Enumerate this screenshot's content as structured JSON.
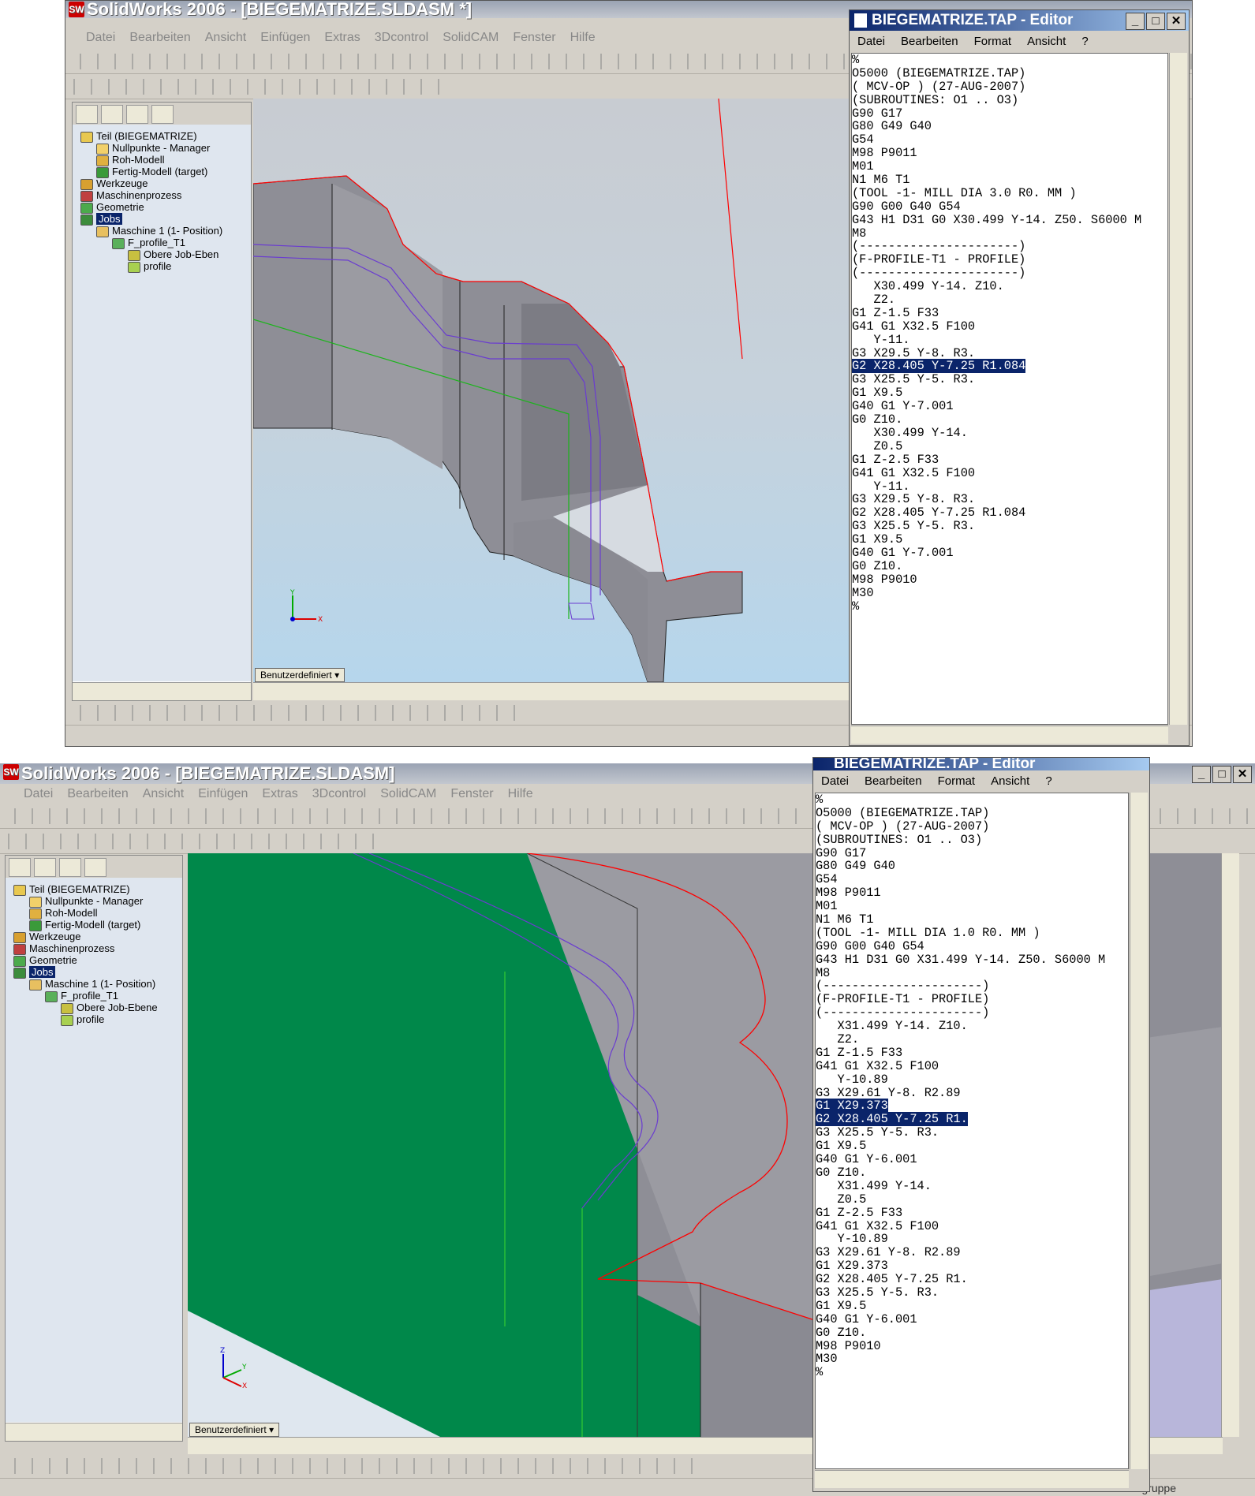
{
  "top": {
    "app_title": "SolidWorks 2006 - [BIEGEMATRIZE.SLDASM *]",
    "menu": [
      "Datei",
      "Bearbeiten",
      "Ansicht",
      "Einfügen",
      "Extras",
      "3Dcontrol",
      "SolidCAM",
      "Fenster",
      "Hilfe"
    ],
    "tree": [
      {
        "label": "Teil (BIEGEMATRIZE)",
        "icon": "part-icon"
      },
      {
        "label": "Nullpunkte - Manager",
        "icon": "origin-icon"
      },
      {
        "label": "Roh-Modell",
        "icon": "stock-icon"
      },
      {
        "label": "Fertig-Modell (target)",
        "icon": "target-icon"
      },
      {
        "label": "Werkzeuge",
        "icon": "tools-icon"
      },
      {
        "label": "Maschinenprozess",
        "icon": "machine-process-icon"
      },
      {
        "label": "Geometrie",
        "icon": "geometry-icon"
      },
      {
        "label": "Jobs",
        "icon": "jobs-icon"
      },
      {
        "label": "Maschine 1 (1- Position)",
        "icon": "machine-icon"
      },
      {
        "label": "F_profile_T1",
        "icon": "profile-job-icon"
      },
      {
        "label": "Obere Job-Eben",
        "icon": "plane-icon"
      },
      {
        "label": "profile",
        "icon": "profile-icon"
      }
    ],
    "view_mode": "Benutzerdefiniert",
    "editor": {
      "title": "BIEGEMATRIZE.TAP - Editor",
      "menu": [
        "Datei",
        "Bearbeiten",
        "Format",
        "Ansicht",
        "?"
      ],
      "lines": [
        "%",
        "O5000 (BIEGEMATRIZE.TAP)",
        "( MCV-OP ) (27-AUG-2007)",
        "(SUBROUTINES: O1 .. O3)",
        "G90 G17",
        "G80 G49 G40",
        "G54",
        "M98 P9011",
        "M01",
        "N1 M6 T1",
        "(TOOL -1- MILL DIA 3.0 R0. MM )",
        "G90 G00 G40 G54",
        "G43 H1 D31 G0 X30.499 Y-14. Z50. S6000 M",
        "M8",
        "(----------------------)",
        "(F-PROFILE-T1 - PROFILE)",
        "(----------------------)",
        "   X30.499 Y-14. Z10.",
        "   Z2.",
        "G1 Z-1.5 F33",
        "G41 G1 X32.5 F100",
        "   Y-11.",
        "G3 X29.5 Y-8. R3.",
        "G2 X28.405 Y-7.25 R1.084",
        "G3 X25.5 Y-5. R3.",
        "G1 X9.5",
        "G40 G1 Y-7.001",
        "G0 Z10.",
        "   X30.499 Y-14.",
        "   Z0.5",
        "G1 Z-2.5 F33",
        "G41 G1 X32.5 F100",
        "   Y-11.",
        "G3 X29.5 Y-8. R3.",
        "G2 X28.405 Y-7.25 R1.084",
        "G3 X25.5 Y-5. R3.",
        "G1 X9.5",
        "G40 G1 Y-7.001",
        "G0 Z10.",
        "M98 P9010",
        "M30",
        "%"
      ],
      "highlighted": [
        23
      ]
    }
  },
  "bottom": {
    "app_title": "SolidWorks 2006 - [BIEGEMATRIZE.SLDASM]",
    "menu": [
      "Datei",
      "Bearbeiten",
      "Ansicht",
      "Einfügen",
      "Extras",
      "3Dcontrol",
      "SolidCAM",
      "Fenster",
      "Hilfe"
    ],
    "tree": [
      {
        "label": "Teil (BIEGEMATRIZE)",
        "icon": "part-icon"
      },
      {
        "label": "Nullpunkte - Manager",
        "icon": "origin-icon"
      },
      {
        "label": "Roh-Modell",
        "icon": "stock-icon"
      },
      {
        "label": "Fertig-Modell (target)",
        "icon": "target-icon"
      },
      {
        "label": "Werkzeuge",
        "icon": "tools-icon"
      },
      {
        "label": "Maschinenprozess",
        "icon": "machine-process-icon"
      },
      {
        "label": "Geometrie",
        "icon": "geometry-icon"
      },
      {
        "label": "Jobs",
        "icon": "jobs-icon"
      },
      {
        "label": "Maschine 1 (1- Position)",
        "icon": "machine-icon"
      },
      {
        "label": "F_profile_T1",
        "icon": "profile-job-icon"
      },
      {
        "label": "Obere Job-Ebene",
        "icon": "plane-icon"
      },
      {
        "label": "profile",
        "icon": "profile-icon"
      }
    ],
    "view_mode": "Benutzerdefiniert",
    "status_text": "Bearbeiten Baugruppe",
    "editor": {
      "title": "BIEGEMATRIZE.TAP - Editor",
      "menu": [
        "Datei",
        "Bearbeiten",
        "Format",
        "Ansicht",
        "?"
      ],
      "lines": [
        "%",
        "O5000 (BIEGEMATRIZE.TAP)",
        "( MCV-OP ) (27-AUG-2007)",
        "(SUBROUTINES: O1 .. O3)",
        "G90 G17",
        "G80 G49 G40",
        "G54",
        "M98 P9011",
        "M01",
        "N1 M6 T1",
        "(TOOL -1- MILL DIA 1.0 R0. MM )",
        "G90 G00 G40 G54",
        "G43 H1 D31 G0 X31.499 Y-14. Z50. S6000 M",
        "M8",
        "(----------------------)",
        "(F-PROFILE-T1 - PROFILE)",
        "(----------------------)",
        "   X31.499 Y-14. Z10.",
        "   Z2.",
        "G1 Z-1.5 F33",
        "G41 G1 X32.5 F100",
        "   Y-10.89",
        "G3 X29.61 Y-8. R2.89",
        "G1 X29.373",
        "G2 X28.405 Y-7.25 R1.",
        "G3 X25.5 Y-5. R3.",
        "G1 X9.5",
        "G40 G1 Y-6.001",
        "G0 Z10.",
        "   X31.499 Y-14.",
        "   Z0.5",
        "G1 Z-2.5 F33",
        "G41 G1 X32.5 F100",
        "   Y-10.89",
        "G3 X29.61 Y-8. R2.89",
        "G1 X29.373",
        "G2 X28.405 Y-7.25 R1.",
        "G3 X25.5 Y-5. R3.",
        "G1 X9.5",
        "G40 G1 Y-6.001",
        "G0 Z10.",
        "M98 P9010",
        "M30",
        "%"
      ],
      "highlighted": [
        23,
        24
      ]
    }
  },
  "colors": {
    "highlight": "#0a246a",
    "editor_title": "#0a246a",
    "sw_title": "#c00000",
    "face_green": "#00884a",
    "part_gray": "#8e8e96",
    "toolpath": "#6a3cd0",
    "edge": "#ff0000"
  }
}
